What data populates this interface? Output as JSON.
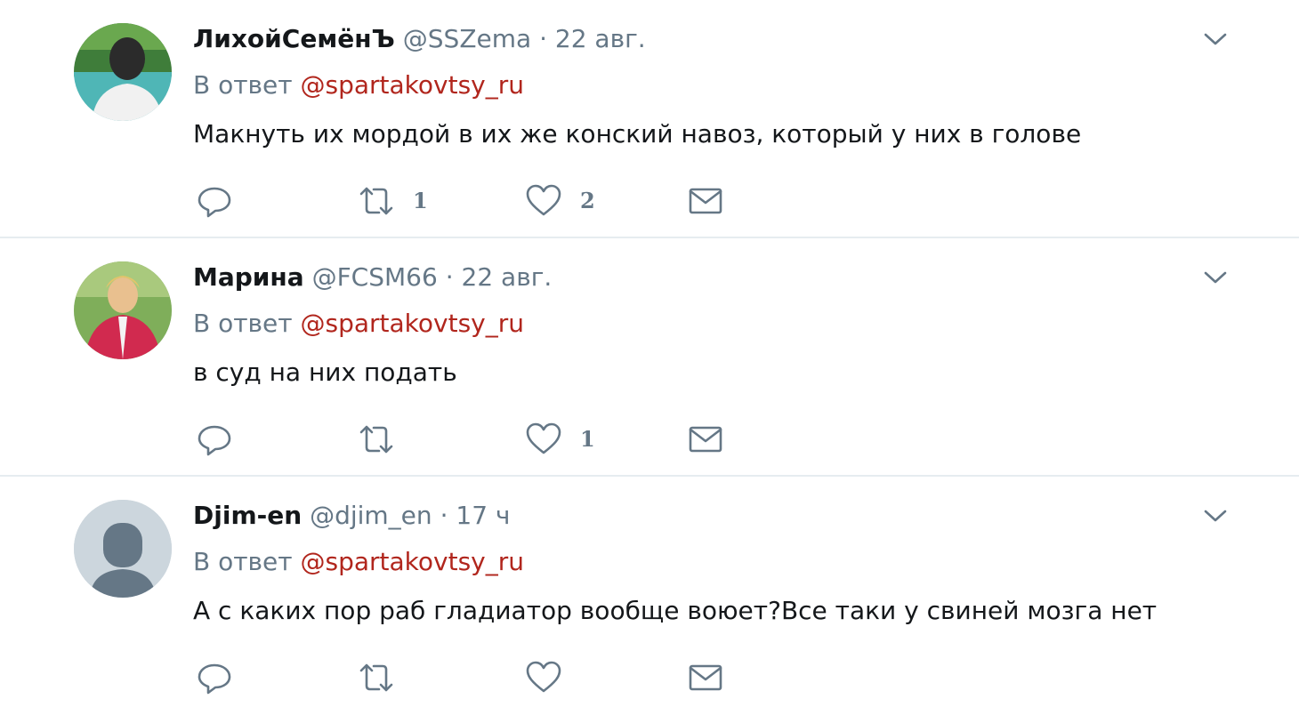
{
  "icons": {
    "reply": "reply-icon",
    "retweet": "retweet-icon",
    "like": "heart-icon",
    "dm": "envelope-icon",
    "more": "chevron-down-icon"
  },
  "colors": {
    "mention": "#b1261d",
    "secondary_text": "#657786",
    "divider": "#e6ecf0"
  },
  "tweets": [
    {
      "name": "ЛихойСемёнЪ",
      "handle": "@SSZema",
      "separator": "·",
      "time": "22 авг.",
      "reply_prefix": "В ответ",
      "reply_to": "@spartakovtsy_ru",
      "text": "Макнуть их мордой в их же конский навоз, который у них в голове",
      "retweets": "1",
      "likes": "2"
    },
    {
      "name": "Марина",
      "handle": "@FCSM66",
      "separator": "·",
      "time": "22 авг.",
      "reply_prefix": "В ответ",
      "reply_to": "@spartakovtsy_ru",
      "text": "в суд на них подать",
      "retweets": "",
      "likes": "1"
    },
    {
      "name": "Djim-en",
      "handle": "@djim_en",
      "separator": "·",
      "time": "17 ч",
      "reply_prefix": "В ответ",
      "reply_to": "@spartakovtsy_ru",
      "text": "А с каких пор раб гладиатор вообще воюет?Все таки у свиней мозга нет",
      "retweets": "",
      "likes": ""
    }
  ]
}
